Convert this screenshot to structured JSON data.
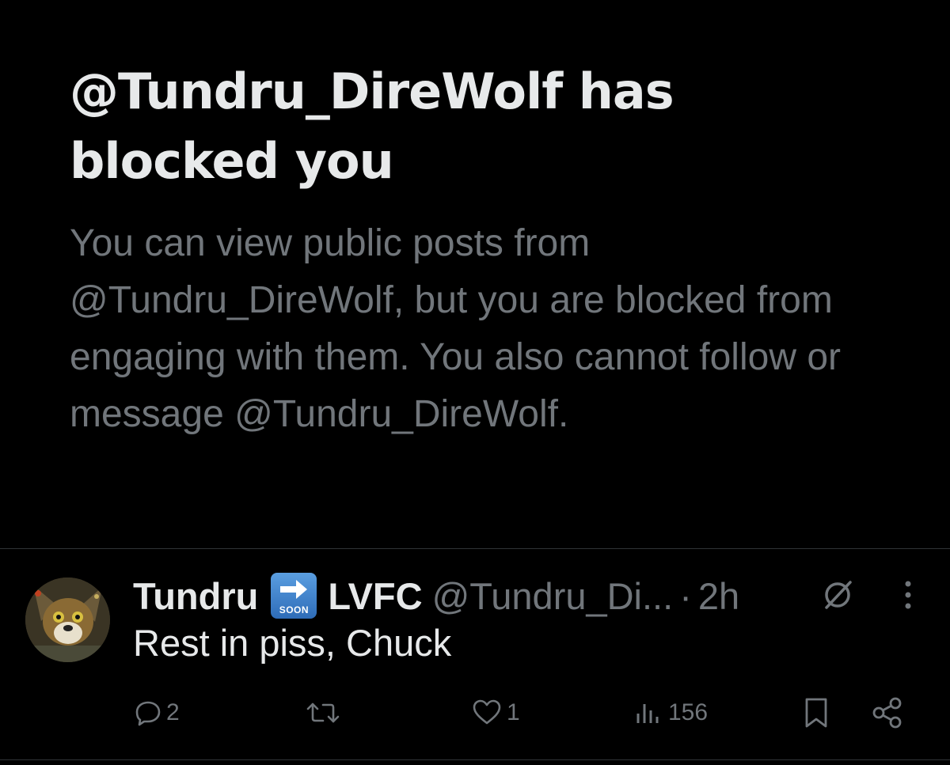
{
  "blocked_notice": {
    "title": "@Tundru_DireWolf has blocked you",
    "description": "You can view public posts from @Tundru_DireWolf, but you are blocked from engaging with them. You also cannot follow or message @Tundru_DireWolf."
  },
  "tweet": {
    "display_name": "Tundru",
    "badge_text": "SOON",
    "display_name_suffix": "LVFC",
    "handle": "@Tundru_Di...",
    "separator": "·",
    "time": "2h",
    "text": "Rest in piss, Chuck",
    "actions": {
      "replies": "2",
      "reposts": "",
      "likes": "1",
      "views": "156"
    }
  },
  "colors": {
    "background": "#000000",
    "primary_text": "#e7e9ea",
    "secondary_text": "#71767b",
    "divider": "#2f3336",
    "badge_blue": "#3b82d4"
  },
  "icons": [
    "soon-arrow-icon",
    "grok-icon",
    "more-icon",
    "reply-icon",
    "repost-icon",
    "like-icon",
    "views-icon",
    "bookmark-icon",
    "share-icon"
  ]
}
